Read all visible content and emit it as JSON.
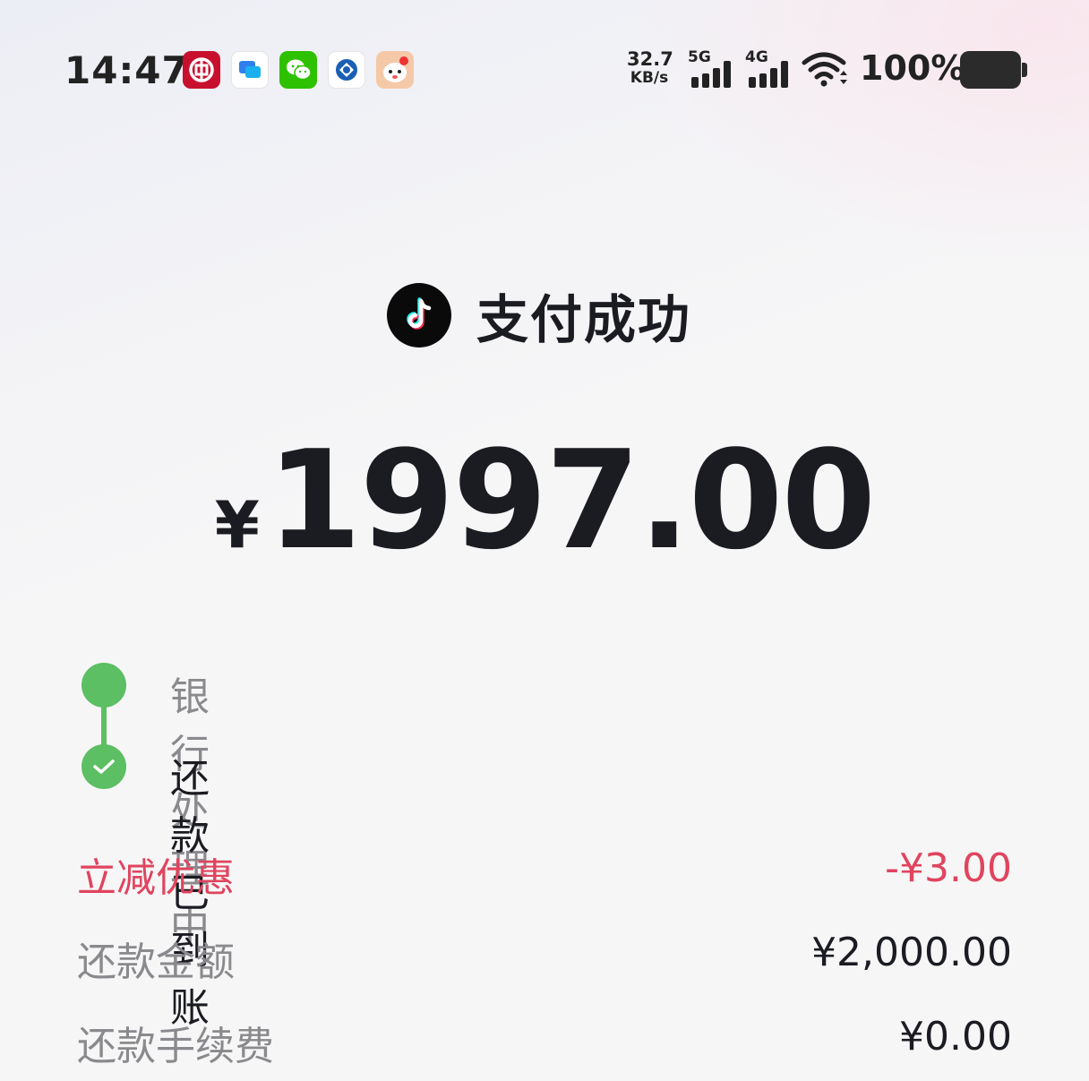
{
  "status_bar": {
    "time": "14:47",
    "app_icons": [
      "bank-of-china-icon",
      "messages-icon",
      "wechat-icon",
      "ccb-bank-icon",
      "mascot-app-icon"
    ],
    "net_speed_value": "32.7",
    "net_speed_unit": "KB/s",
    "signal_5g_label": "5G",
    "signal_4g_label": "4G",
    "battery_percent": "100%"
  },
  "header": {
    "app_icon": "tiktok-icon",
    "title": "支付成功"
  },
  "amount": {
    "currency": "¥",
    "value": "1997.00"
  },
  "progress": {
    "steps": [
      {
        "label": "银行处理中"
      },
      {
        "label": "还款已到账"
      }
    ],
    "accent_color": "#5cbf63"
  },
  "details": [
    {
      "label": "立减优惠",
      "value": "-¥3.00",
      "color": "#e0445e"
    },
    {
      "label": "还款金额",
      "value": "¥2,000.00"
    },
    {
      "label": "还款手续费",
      "value": "¥0.00"
    }
  ]
}
